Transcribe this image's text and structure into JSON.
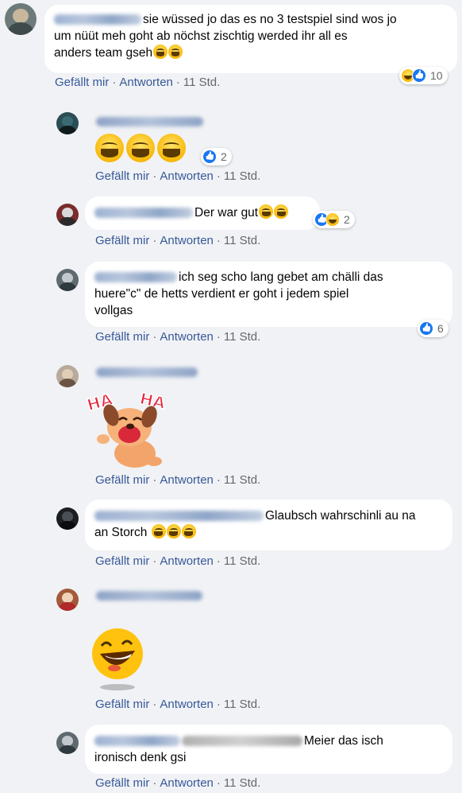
{
  "actions": {
    "like": "Gefällt mir",
    "reply": "Antworten",
    "time": "11 Std.",
    "sep": "·"
  },
  "comments": [
    {
      "text_line1": "sie wüssed jo das es no 3 testspiel sind wos jo",
      "text_line2": "um nüüt meh goht ab nöchst zischtig werded ihr all es",
      "text_line3": "anders team gseh",
      "reaction_count": "10"
    },
    {
      "reaction_count": "2"
    },
    {
      "text": "Der war gut",
      "reaction_count": "2"
    },
    {
      "text_line1": "ich seg scho lang gebet am chälli das",
      "text_line2": "huere\"c\" de hetts verdient er goht i jedem spiel",
      "text_line3": "vollgas",
      "reaction_count": "6"
    },
    {
      "sticker_text": "HA HA"
    },
    {
      "text_line1": "Glaubsch wahrschinli au na",
      "text_line2": "an Storch"
    },
    {},
    {
      "text_line1": "Meier das isch",
      "text_line2": "ironisch denk gsi"
    }
  ],
  "colors": {
    "background": "#f0f2f5",
    "link": "#385898",
    "meta": "#65676b",
    "like_blue": "#1877f2"
  }
}
